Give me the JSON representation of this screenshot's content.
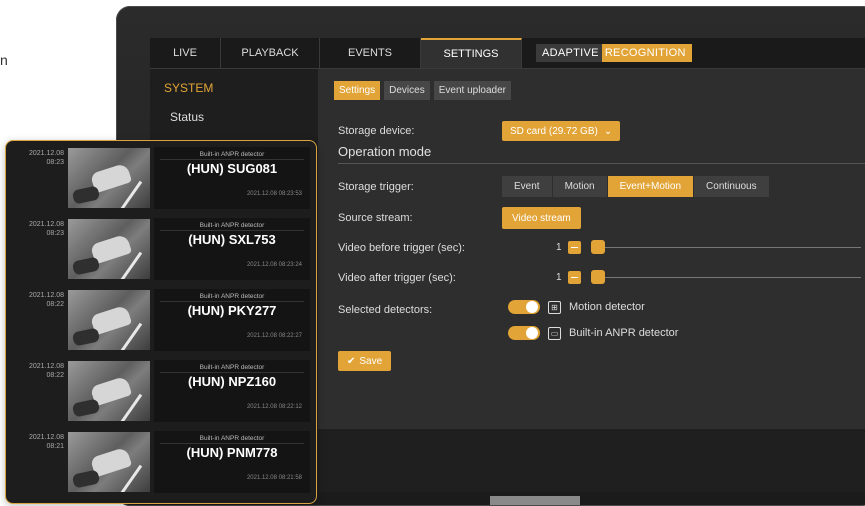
{
  "edge_text": "n",
  "topnav": {
    "tabs": [
      {
        "label": "LIVE"
      },
      {
        "label": "PLAYBACK"
      },
      {
        "label": "EVENTS"
      },
      {
        "label": "SETTINGS"
      }
    ],
    "brand_part1": "ADAPTIVE",
    "brand_part2": "RECOGNITION"
  },
  "sidebar": {
    "section": "SYSTEM",
    "item": "Status"
  },
  "subtabs": [
    "Settings",
    "Devices",
    "Event uploader"
  ],
  "settings": {
    "storage_device_label": "Storage device:",
    "storage_device_value": "SD card (29.72 GB)",
    "operation_mode_title": "Operation mode",
    "storage_trigger_label": "Storage trigger:",
    "trigger_options": [
      "Event",
      "Motion",
      "Event+Motion",
      "Continuous"
    ],
    "trigger_selected": "Event+Motion",
    "source_stream_label": "Source stream:",
    "source_stream_button": "Video stream",
    "video_before_label": "Video before trigger (sec):",
    "video_before_value": "1",
    "video_after_label": "Video after trigger (sec):",
    "video_after_value": "1",
    "selected_detectors_label": "Selected detectors:",
    "detectors": [
      {
        "name": "Motion detector",
        "enabled": true
      },
      {
        "name": "Built-in ANPR detector",
        "enabled": true
      }
    ],
    "save_label": "Save"
  },
  "anpr_cards": [
    {
      "date": "2021.12.08",
      "time": "08:23",
      "detector": "Built-in ANPR detector",
      "plate": "(HUN) SUG081",
      "timestamp": "2021.12.08 08:23:53"
    },
    {
      "date": "2021.12.08",
      "time": "08:23",
      "detector": "Built-in ANPR detector",
      "plate": "(HUN) SXL753",
      "timestamp": "2021.12.08 08:23:24"
    },
    {
      "date": "2021.12.08",
      "time": "08:22",
      "detector": "Built-in ANPR detector",
      "plate": "(HUN) PKY277",
      "timestamp": "2021.12.08 08:22:27"
    },
    {
      "date": "2021.12.08",
      "time": "08:22",
      "detector": "Built-in ANPR detector",
      "plate": "(HUN) NPZ160",
      "timestamp": "2021.12.08 08:22:12"
    },
    {
      "date": "2021.12.08",
      "time": "08:21",
      "detector": "Built-in ANPR detector",
      "plate": "(HUN) PNM778",
      "timestamp": "2021.12.08 08:21:58"
    }
  ],
  "colors": {
    "accent": "#e2a437",
    "screen_bg": "#2e2e2e",
    "bezel": "#1f1f1f"
  }
}
